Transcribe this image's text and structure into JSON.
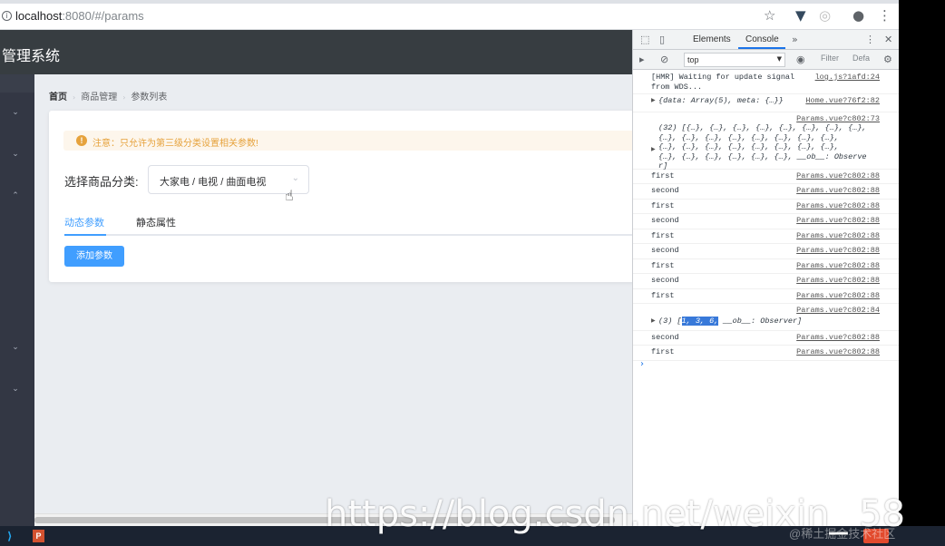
{
  "browser": {
    "url_host": "localhost",
    "url_path": ":8080/#/params",
    "icons": [
      "info-icon",
      "star-icon",
      "vue-devtools-icon",
      "extension-icon",
      "account-icon",
      "menu-kebab-icon"
    ]
  },
  "app": {
    "title": "管理系统",
    "breadcrumb": [
      "首页",
      "商品管理",
      "参数列表"
    ],
    "alert": "注意：只允许为第三级分类设置相关参数!",
    "category_label": "选择商品分类:",
    "category_value": "大家电 / 电视 / 曲面电视",
    "tabs": [
      {
        "label": "动态参数",
        "active": true
      },
      {
        "label": "静态属性",
        "active": false
      }
    ],
    "add_button": "添加参数"
  },
  "devtools": {
    "tabs": [
      "Elements",
      "Console"
    ],
    "active_tab": "Console",
    "context": "top",
    "filter_placeholder": "Filter",
    "levels": "Defa",
    "lines": [
      {
        "msg": "[HMR] Waiting for update signal\nfrom WDS...",
        "src": "log.js?1afd:24"
      },
      {
        "msg": "{data: Array(5), meta: {…}}",
        "src": "Home.vue?76f2:82",
        "expandable": true
      },
      {
        "msg": "(32) [{…}, {…}, {…}, {…}, {…}, {…}, {…}, {…},\n{…}, {…}, {…}, {…}, {…}, {…}, {…}, {…},\n{…}, {…}, {…}, {…}, {…}, {…}, {…}, {…},\n{…}, {…}, {…}, {…}, {…}, {…}, __ob__: Observe\nr]",
        "src": "Params.vue?c802:73",
        "expandable": true
      },
      {
        "msg": "first",
        "src": "Params.vue?c802:88"
      },
      {
        "msg": "second",
        "src": "Params.vue?c802:88"
      },
      {
        "msg": "first",
        "src": "Params.vue?c802:88"
      },
      {
        "msg": "second",
        "src": "Params.vue?c802:88"
      },
      {
        "msg": "first",
        "src": "Params.vue?c802:88"
      },
      {
        "msg": "second",
        "src": "Params.vue?c802:88"
      },
      {
        "msg": "first",
        "src": "Params.vue?c802:88"
      },
      {
        "msg": "second",
        "src": "Params.vue?c802:88"
      },
      {
        "msg": "first",
        "src": "Params.vue?c802:88"
      },
      {
        "msg_prefix": "(3) [",
        "msg_highlight": "1, 3, 6,",
        "msg_suffix": " __ob__: Observer]",
        "src": "Params.vue?c802:84",
        "expandable": true
      },
      {
        "msg": "second",
        "src": "Params.vue?c802:88"
      },
      {
        "msg": "first",
        "src": "Params.vue?c802:88"
      }
    ]
  },
  "watermark": "https://blog.csdn.net/weixin_   58",
  "watermark2": "@稀土掘金技术社区",
  "colors": {
    "header": "#373d41",
    "aside": "#333744",
    "primary": "#409eff",
    "warning": "#e6a23c"
  }
}
